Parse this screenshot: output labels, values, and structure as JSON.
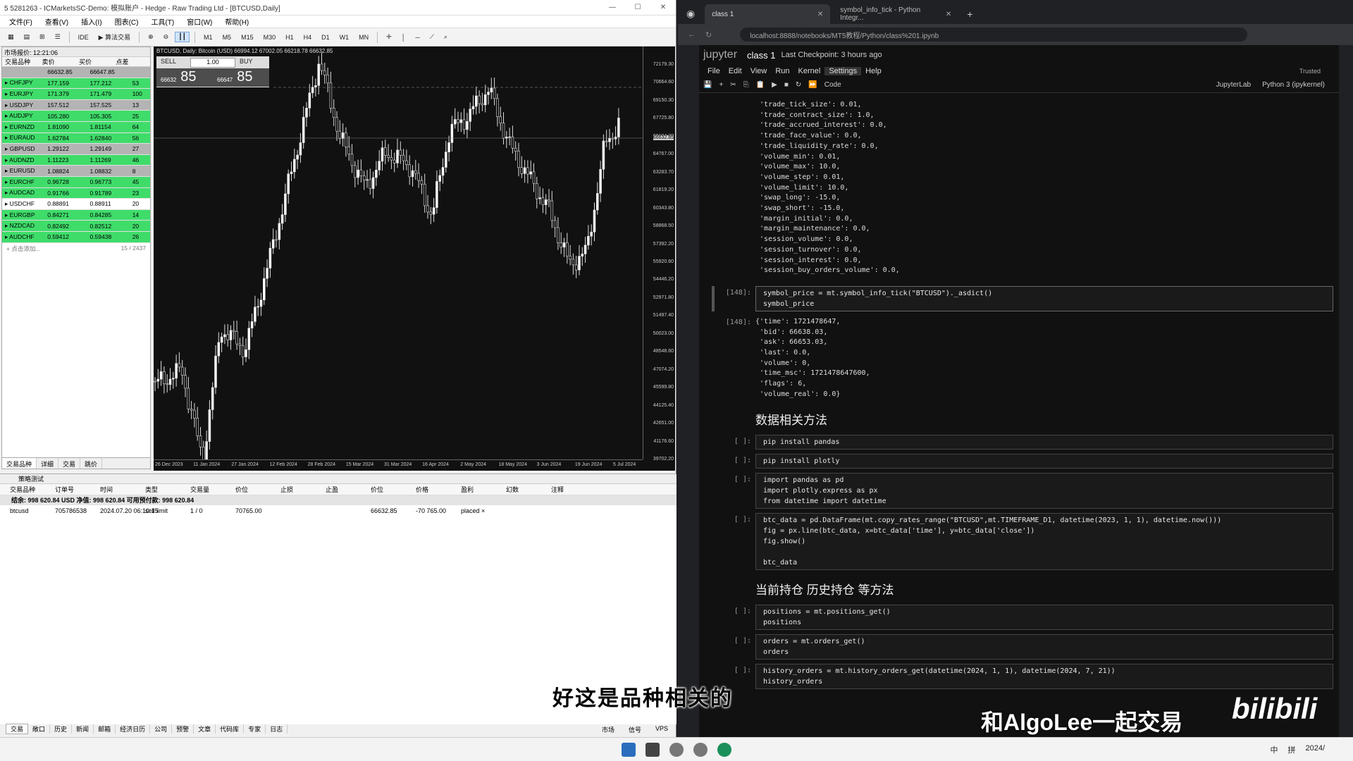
{
  "mt5": {
    "title": "5 5281263 - ICMarketsSC-Demo: 模拟账户 - Hedge - Raw Trading Ltd - [BTCUSD,Daily]",
    "menu": [
      "文件(F)",
      "查看(V)",
      "插入(I)",
      "图表(C)",
      "工具(T)",
      "窗口(W)",
      "帮助(H)"
    ],
    "toolbar": [
      "IDE",
      "算法交易",
      "M1",
      "M5",
      "M15",
      "M30",
      "H1",
      "H4",
      "D1",
      "W1",
      "MN"
    ],
    "watch_title": "市场报价: 12:21:06",
    "watch_cols": [
      "交易品种",
      "卖价",
      "买价",
      "点差"
    ],
    "watch_rows": [
      {
        "sym": "",
        "bid": "66632.85",
        "ask": "66647.85",
        "spread": "",
        "color": "grey"
      },
      {
        "sym": "CHFJPY",
        "bid": "177.159",
        "ask": "177.212",
        "spread": "53",
        "color": "green"
      },
      {
        "sym": "EURJPY",
        "bid": "171.379",
        "ask": "171.479",
        "spread": "100",
        "color": "green"
      },
      {
        "sym": "USDJPY",
        "bid": "157.512",
        "ask": "157.525",
        "spread": "13",
        "color": "grey"
      },
      {
        "sym": "AUDJPY",
        "bid": "105.280",
        "ask": "105.305",
        "spread": "25",
        "color": "green"
      },
      {
        "sym": "EURNZD",
        "bid": "1.81090",
        "ask": "1.81154",
        "spread": "64",
        "color": "green"
      },
      {
        "sym": "EURAUD",
        "bid": "1.62784",
        "ask": "1.62840",
        "spread": "56",
        "color": "green"
      },
      {
        "sym": "GBPUSD",
        "bid": "1.29122",
        "ask": "1.29149",
        "spread": "27",
        "color": "grey"
      },
      {
        "sym": "AUDNZD",
        "bid": "1.11223",
        "ask": "1.11269",
        "spread": "46",
        "color": "green"
      },
      {
        "sym": "EURUSD",
        "bid": "1.08824",
        "ask": "1.08832",
        "spread": "8",
        "color": "grey"
      },
      {
        "sym": "EURCHF",
        "bid": "0.96728",
        "ask": "0.96773",
        "spread": "45",
        "color": "green"
      },
      {
        "sym": "AUDCAD",
        "bid": "0.91766",
        "ask": "0.91789",
        "spread": "23",
        "color": "green"
      },
      {
        "sym": "USDCHF",
        "bid": "0.88891",
        "ask": "0.88911",
        "spread": "20",
        "color": "white"
      },
      {
        "sym": "EURGBP",
        "bid": "0.84271",
        "ask": "0.84285",
        "spread": "14",
        "color": "green"
      },
      {
        "sym": "NZDCAD",
        "bid": "0.82492",
        "ask": "0.82512",
        "spread": "20",
        "color": "green"
      },
      {
        "sym": "AUDCHF",
        "bid": "0.59412",
        "ask": "0.59438",
        "spread": "26",
        "color": "green"
      }
    ],
    "watch_add": "+ 点击添加...",
    "watch_count": "15 / 2437",
    "watch_tabs": [
      "交易品种",
      "详细",
      "交易",
      "跳价"
    ],
    "chart_title": "BTCUSD, Daily: Bitcoin (USD)  66994.12 67002.05 66218.78 66632.85",
    "sell": "SELL",
    "buy": "BUY",
    "lot": "1.00",
    "sell_small": "66632",
    "sell_big": "85",
    "buy_small": "66647",
    "buy_big": "85",
    "y_ticks": [
      "72179.30",
      "70664.60",
      "69150.30",
      "67725.80",
      "66194.30",
      "64767.00",
      "63283.70",
      "61819.20",
      "60343.80",
      "58868.50",
      "57392.20",
      "55920.60",
      "54446.20",
      "52971.80",
      "51497.40",
      "50023.00",
      "48548.60",
      "47074.20",
      "45599.80",
      "44125.40",
      "42651.00",
      "41176.60",
      "39702.20"
    ],
    "x_ticks": [
      "26 Dec 2023",
      "11 Jan 2024",
      "27 Jan 2024",
      "12 Feb 2024",
      "28 Feb 2024",
      "15 Mar 2024",
      "31 Mar 2024",
      "16 Apr 2024",
      "2 May 2024",
      "18 May 2024",
      "3 Jun 2024",
      "19 Jun 2024",
      "5 Jul 2024"
    ],
    "price_label": "66632.85",
    "toolbox_head": "策略测试",
    "order_cols": [
      "交易品种",
      "订单号",
      "时间",
      "类型",
      "交易量",
      "价位",
      "止损",
      "止盈",
      "价位",
      "价格",
      "盈利",
      "幻数",
      "注释"
    ],
    "balance_line": "结余: 998 620.84 USD  净值: 998 620.84  可用预付款: 998 620.84",
    "order_row": [
      "btcusd",
      "705786538",
      "2024.07.20 06:10:15",
      "sell limit",
      "1 / 0",
      "70765.00",
      "",
      "",
      "66632.85",
      "-70 765.00",
      "placed ×"
    ],
    "bottom_tabs": [
      "交易",
      "敞口",
      "历史",
      "新闻",
      "邮箱",
      "经济日历",
      "公司",
      "预警",
      "文章",
      "代码库",
      "专家",
      "日志"
    ],
    "status": [
      "市场",
      "信号",
      "VPS"
    ]
  },
  "browser": {
    "tabs": [
      {
        "label": "class 1",
        "active": true
      },
      {
        "label": "symbol_info_tick - Python Integr...",
        "active": false
      }
    ],
    "url": "localhost:8888/notebooks/MT5教程/Python/class%201.ipynb"
  },
  "jupyter": {
    "logo": "jupyter",
    "notebook_title": "class 1",
    "checkpoint": "Last Checkpoint: 3 hours ago",
    "trusted": "Trusted",
    "menu": [
      "File",
      "Edit",
      "View",
      "Run",
      "Kernel",
      "Settings",
      "Help"
    ],
    "cell_type": "Code",
    "jupyterlab": "JupyterLab",
    "kernel": "Python 3 (ipykernel)",
    "top_output": " 'trade_tick_size': 0.01,\n 'trade_contract_size': 1.0,\n 'trade_accrued_interest': 0.0,\n 'trade_face_value': 0.0,\n 'trade_liquidity_rate': 0.0,\n 'volume_min': 0.01,\n 'volume_max': 10.0,\n 'volume_step': 0.01,\n 'volume_limit': 10.0,\n 'swap_long': -15.0,\n 'swap_short': -15.0,\n 'margin_initial': 0.0,\n 'margin_maintenance': 0.0,\n 'session_volume': 0.0,\n 'session_turnover': 0.0,\n 'session_interest': 0.0,\n 'session_buy_orders_volume': 0.0,",
    "cell148_prompt": "[148]:",
    "cell148_code": "symbol_price = mt.symbol_info_tick(\"BTCUSD\")._asdict()\nsymbol_price",
    "out148_prompt": "[148]:",
    "out148": "{'time': 1721478647,\n 'bid': 66638.03,\n 'ask': 66653.03,\n 'last': 0.0,\n 'volume': 0,\n 'time_msc': 1721478647600,\n 'flags': 6,\n 'volume_real': 0.0}",
    "h_data": "数据相关方法",
    "empty_prompt": "[ ]:",
    "c1": "pip install pandas",
    "c2": "pip install plotly",
    "c3": "import pandas as pd\nimport plotly.express as px\nfrom datetime import datetime",
    "c4": "btc_data = pd.DataFrame(mt.copy_rates_range(\"BTCUSD\",mt.TIMEFRAME_D1, datetime(2023, 1, 1), datetime.now()))\nfig = px.line(btc_data, x=btc_data['time'], y=btc_data['close'])\nfig.show()\n\nbtc_data",
    "h_pos": "当前持仓 历史持仓 等方法",
    "c5": "positions = mt.positions_get()\npositions",
    "c6": "orders = mt.orders_get()\norders",
    "c7": "history_orders = mt.history_orders_get(datetime(2024, 1, 1), datetime(2024, 7, 21))\nhistory_orders"
  },
  "overlay": {
    "subtitle": "好这是品种相关的",
    "watermark": "和AlgoLee一起交易",
    "bili": "bilibili"
  },
  "taskbar": {
    "tray": [
      "中",
      "拼"
    ],
    "date": "2024/"
  }
}
